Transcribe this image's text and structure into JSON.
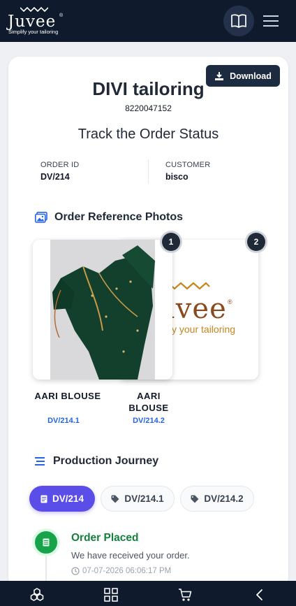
{
  "header": {
    "logo_text": "Juvee",
    "logo_tagline": "Simplify your tailoring",
    "icons": [
      "book-icon",
      "menu-icon"
    ]
  },
  "shop": {
    "name": "DIVI tailoring",
    "phone": "8220047152",
    "download_label": "Download"
  },
  "tracking": {
    "title": "Track the Order Status",
    "order_id_label": "ORDER ID",
    "order_id": "DV/214",
    "customer_label": "CUSTOMER",
    "customer": "bisco"
  },
  "photos": {
    "heading": "Order Reference Photos",
    "items": [
      {
        "badge": "1",
        "title": "AARI BLOUSE",
        "code": "DV/214.1"
      },
      {
        "badge": "2",
        "title": "AARI BLOUSE",
        "code": "DV/214.2",
        "logo_text": "Juvee",
        "logo_tagline": "Simplify your tailoring"
      }
    ]
  },
  "journey": {
    "heading": "Production Journey",
    "chips": [
      {
        "label": "DV/214",
        "active": true,
        "icon": "document-icon"
      },
      {
        "label": "DV/214.1",
        "active": false,
        "icon": "tag-icon"
      },
      {
        "label": "DV/214.2",
        "active": false,
        "icon": "tag-icon"
      }
    ],
    "events": [
      {
        "title": "Order Placed",
        "description": "We have received your order.",
        "timestamp": "07-07-2026 06:06:17 PM"
      }
    ]
  },
  "bottom_nav": [
    "cubes-icon",
    "grid-icon",
    "cart-icon",
    "back-icon"
  ],
  "colors": {
    "navbar": "#0f1b2d",
    "accent": "#5b4ee8",
    "link": "#2563eb",
    "success": "#16a34a",
    "brand_orange": "#c8841e"
  }
}
